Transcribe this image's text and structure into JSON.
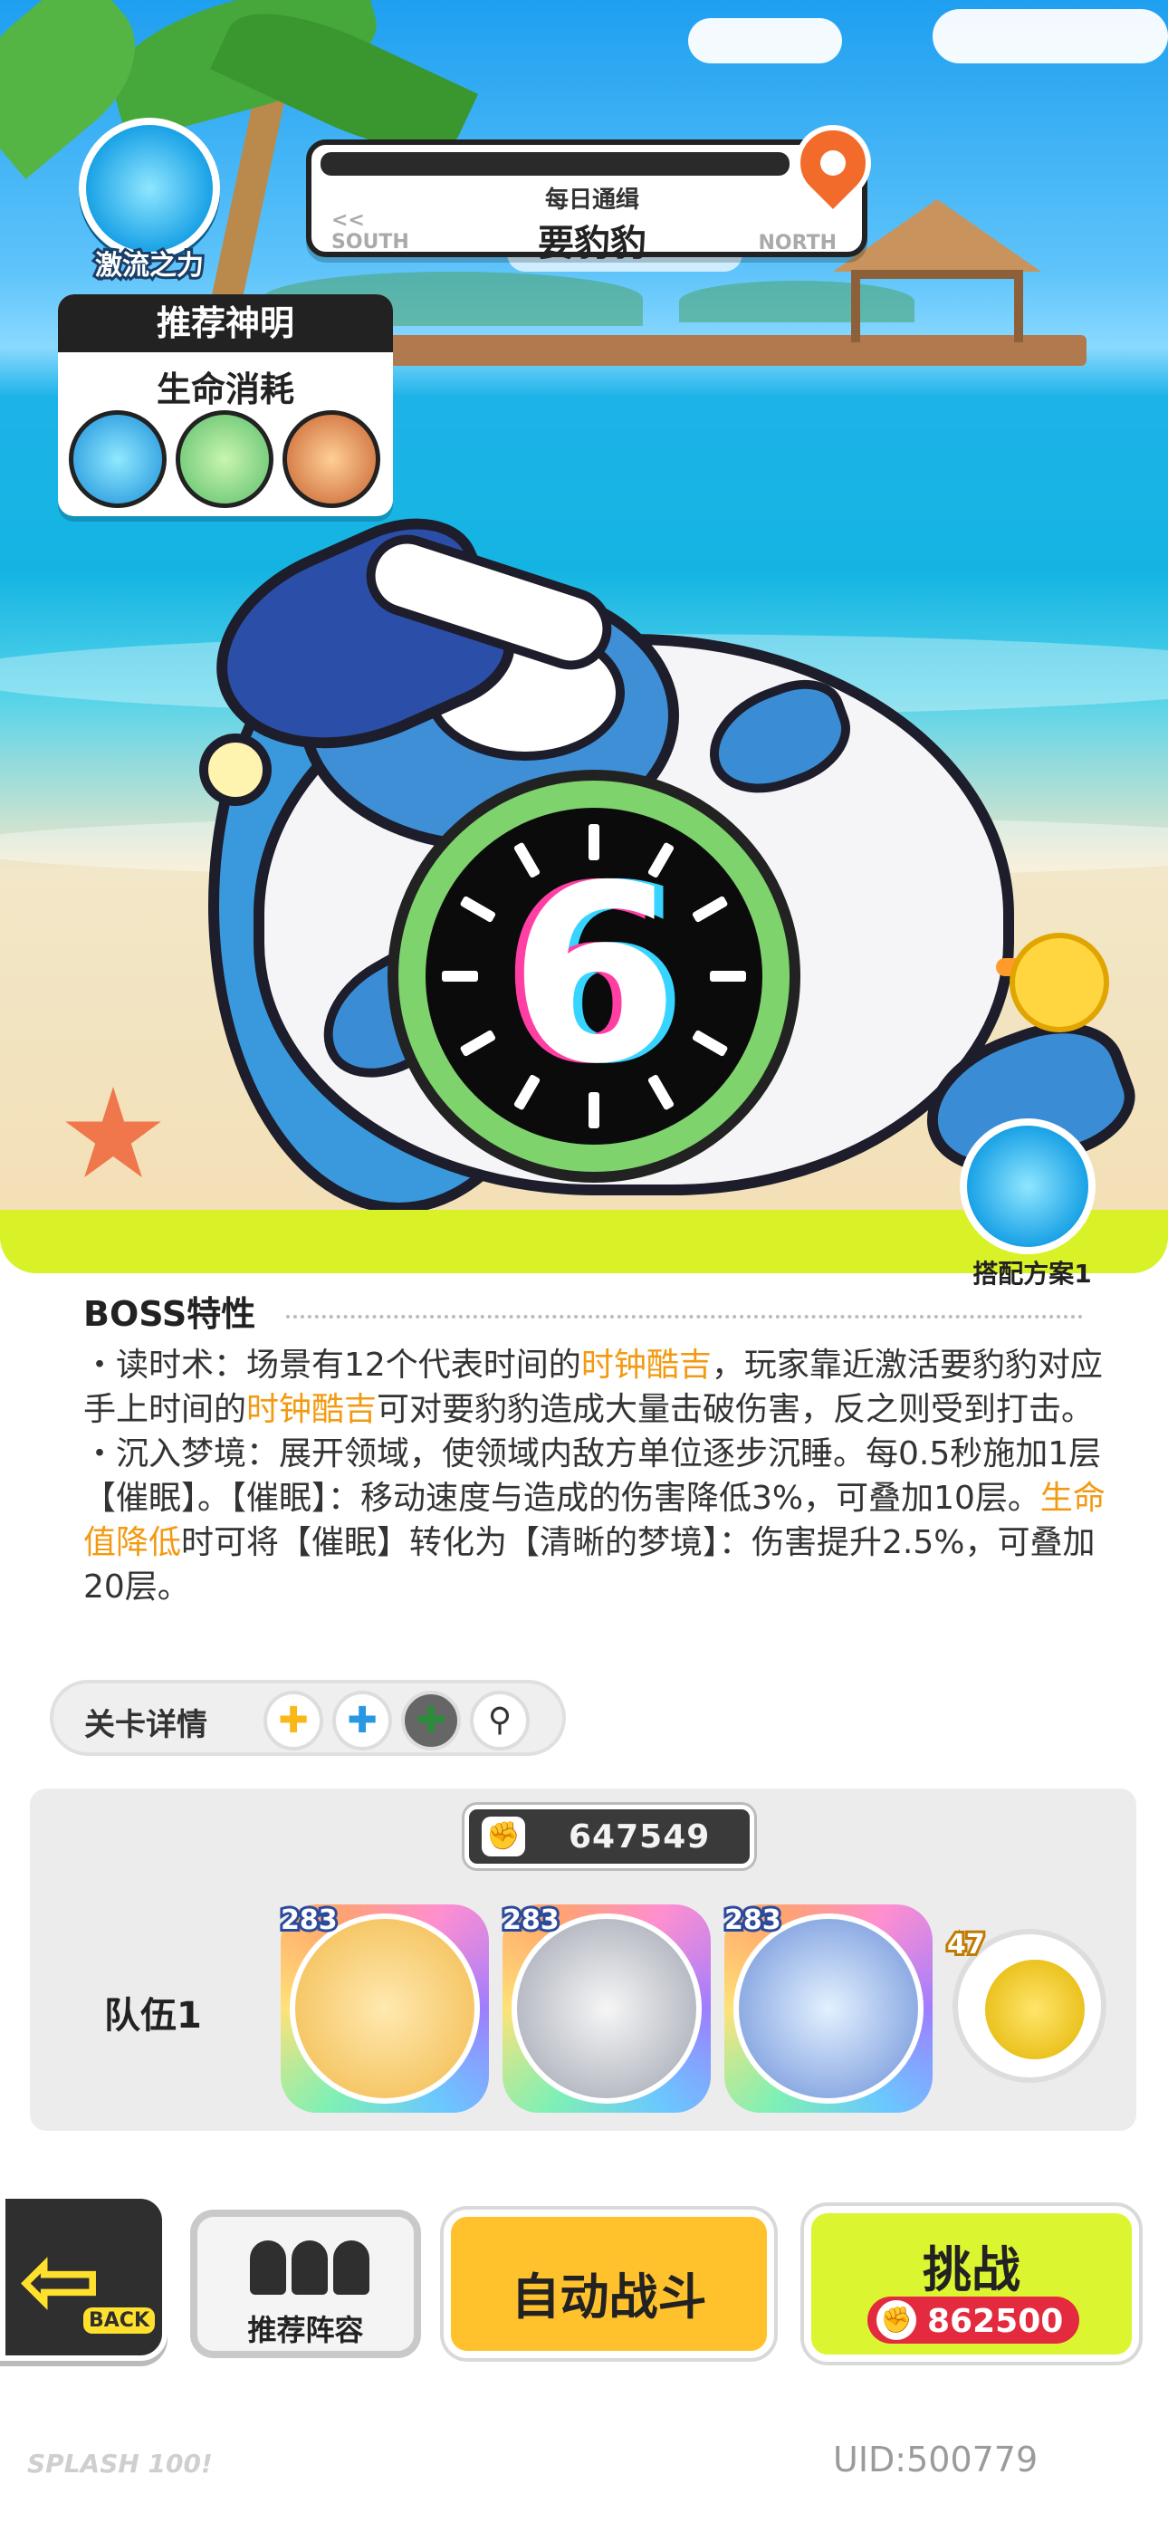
{
  "header": {
    "power_label": "激流之力",
    "bounty_sub": "每日通缉",
    "bounty_title": "要豹豹",
    "dir_south": "SOUTH",
    "dir_south_arrow": "<<",
    "dir_north": "NORTH"
  },
  "recommend": {
    "title": "推荐神明",
    "subtitle": "生命消耗"
  },
  "boss": {
    "clock_number": "6"
  },
  "combo_label": "搭配方案1",
  "features": {
    "title": "BOSS特性",
    "p1_a": "・读时术：场景有12个代表时间的",
    "p1_hl1": "时钟酷吉",
    "p1_b": "，玩家靠近激活要豹豹对应手上时间的",
    "p1_hl2": "时钟酷吉",
    "p1_c": "可对要豹豹造成大量击破伤害，反之则受到打击。",
    "p2_a": "・沉入梦境：展开领域，使领域内敌方单位逐步沉睡。每0.5秒施加1层【催眠】。【催眠】：移动速度与造成的伤害降低3%，可叠加10层。",
    "p2_hl": "生命值降低",
    "p2_b": "时可将【催眠】转化为【清晰的梦境】：伤害提升2.5%，可叠加20层。"
  },
  "stage_detail": {
    "label": "关卡详情"
  },
  "team": {
    "power": "647549",
    "label": "队伍1",
    "heroes": [
      {
        "level": "283"
      },
      {
        "level": "283"
      },
      {
        "level": "283"
      }
    ],
    "pet_level": "47"
  },
  "buttons": {
    "back": "BACK",
    "lineup": "推荐阵容",
    "auto": "自动战斗",
    "challenge": "挑战",
    "challenge_cost": "862500"
  },
  "footer": {
    "logo": "SPLASH 100!",
    "uid": "UID:500779"
  },
  "colors": {
    "accent_yellow": "#d9f227",
    "highlight_orange": "#f29a12",
    "challenge_green": "#dcf531",
    "auto_yellow": "#ffc12c",
    "cost_red": "#e32a3e"
  }
}
